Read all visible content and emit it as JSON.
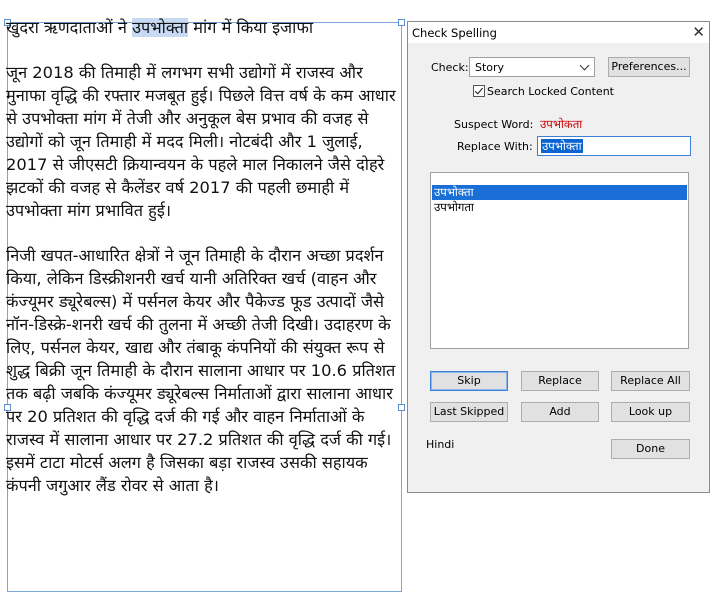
{
  "document": {
    "para1_before": "खुदरा ऋणदाताओं ने ",
    "para1_highlight": "उपभोक्ता",
    "para1_after": " मांग में किया इजाफा",
    "para2": "जून 2018 की तिमाही में लगभग सभी उद्योगों में राजस्व और मुनाफा वृद्धि की रफ्तार मजबूत हुई। पिछले वित्त वर्ष के कम आधार से उपभोक्ता मांग में तेजी और अनुकूल बेस प्रभाव की वजह से उद्योगों को जून तिमाही में मदद मिली। नोटबंदी और 1 जुलाई, 2017 से जीएसटी क्रियान्वयन के पहले माल निकालने जैसे दोहरे झटकों की वजह से कैलेंडर वर्ष 2017 की पहली छमाही में उपभोक्ता मांग प्रभावित हुई।",
    "para3": "निजी खपत-आधारित क्षेत्रों ने जून तिमाही के दौरान अच्छा प्रदर्शन किया, लेकिन डिस्क्रीशनरी खर्च यानी अतिरिक्त खर्च (वाहन और कंज्यूमर ड्यूरेबल्स) में पर्सनल केयर और पैकेज्ड फूड उत्पादों जैसे नॉन-डिस्क्रे-शनरी खर्च की तुलना में अच्छी तेजी दिखी। उदाहरण के लिए, पर्सनल केयर, खाद्य और तंबाकू कंपनियों की संयुक्त रूप से शुद्ध बिक्री जून तिमाही के दौरान सालाना आधार पर 10.6 प्रतिशत तक बढ़ी जबकि कंज्यूमर ड्यूरेबल्स निर्माताओं द्वारा सालाना आधार पर 20 प्रतिशत की वृद्धि दर्ज की गई और वाहन निर्माताओं के राजस्व में सालाना आधार पर 27.2 प्रतिशत की वृद्धि दर्ज की गई। इसमें टाटा मोटर्स अलग है जिसका बड़ा राजस्व उसकी सहायक कंपनी जगुआर लैंड रोवर से आता है।"
  },
  "dialog": {
    "title": "Check Spelling",
    "close_glyph": "✕",
    "check_label": "Check:",
    "check_value": "Story",
    "preferences_label": "Preferences...",
    "search_locked_label": "Search Locked Content",
    "search_locked_checked": true,
    "suspect_label": "Suspect Word:",
    "suspect_value": "उपभोकता",
    "replace_label": "Replace With:",
    "replace_value": "उपभोक्ता",
    "suggestions": [
      "उपभोक्ता",
      "उपभोगता"
    ],
    "buttons": {
      "skip": "Skip",
      "replace": "Replace",
      "replace_all": "Replace All",
      "last_skipped": "Last Skipped",
      "add": "Add",
      "look_up": "Look up",
      "done": "Done"
    },
    "language": "Hindi"
  },
  "icons": {
    "close": "close-icon",
    "dropdown": "chevron-down-icon",
    "checkbox": "checkmark-icon"
  },
  "colors": {
    "selection_blue": "#1a6fd6",
    "suspect_red": "#cc0000",
    "frame_border": "#7aa6dc",
    "dialog_bg": "#f0f0f0"
  }
}
